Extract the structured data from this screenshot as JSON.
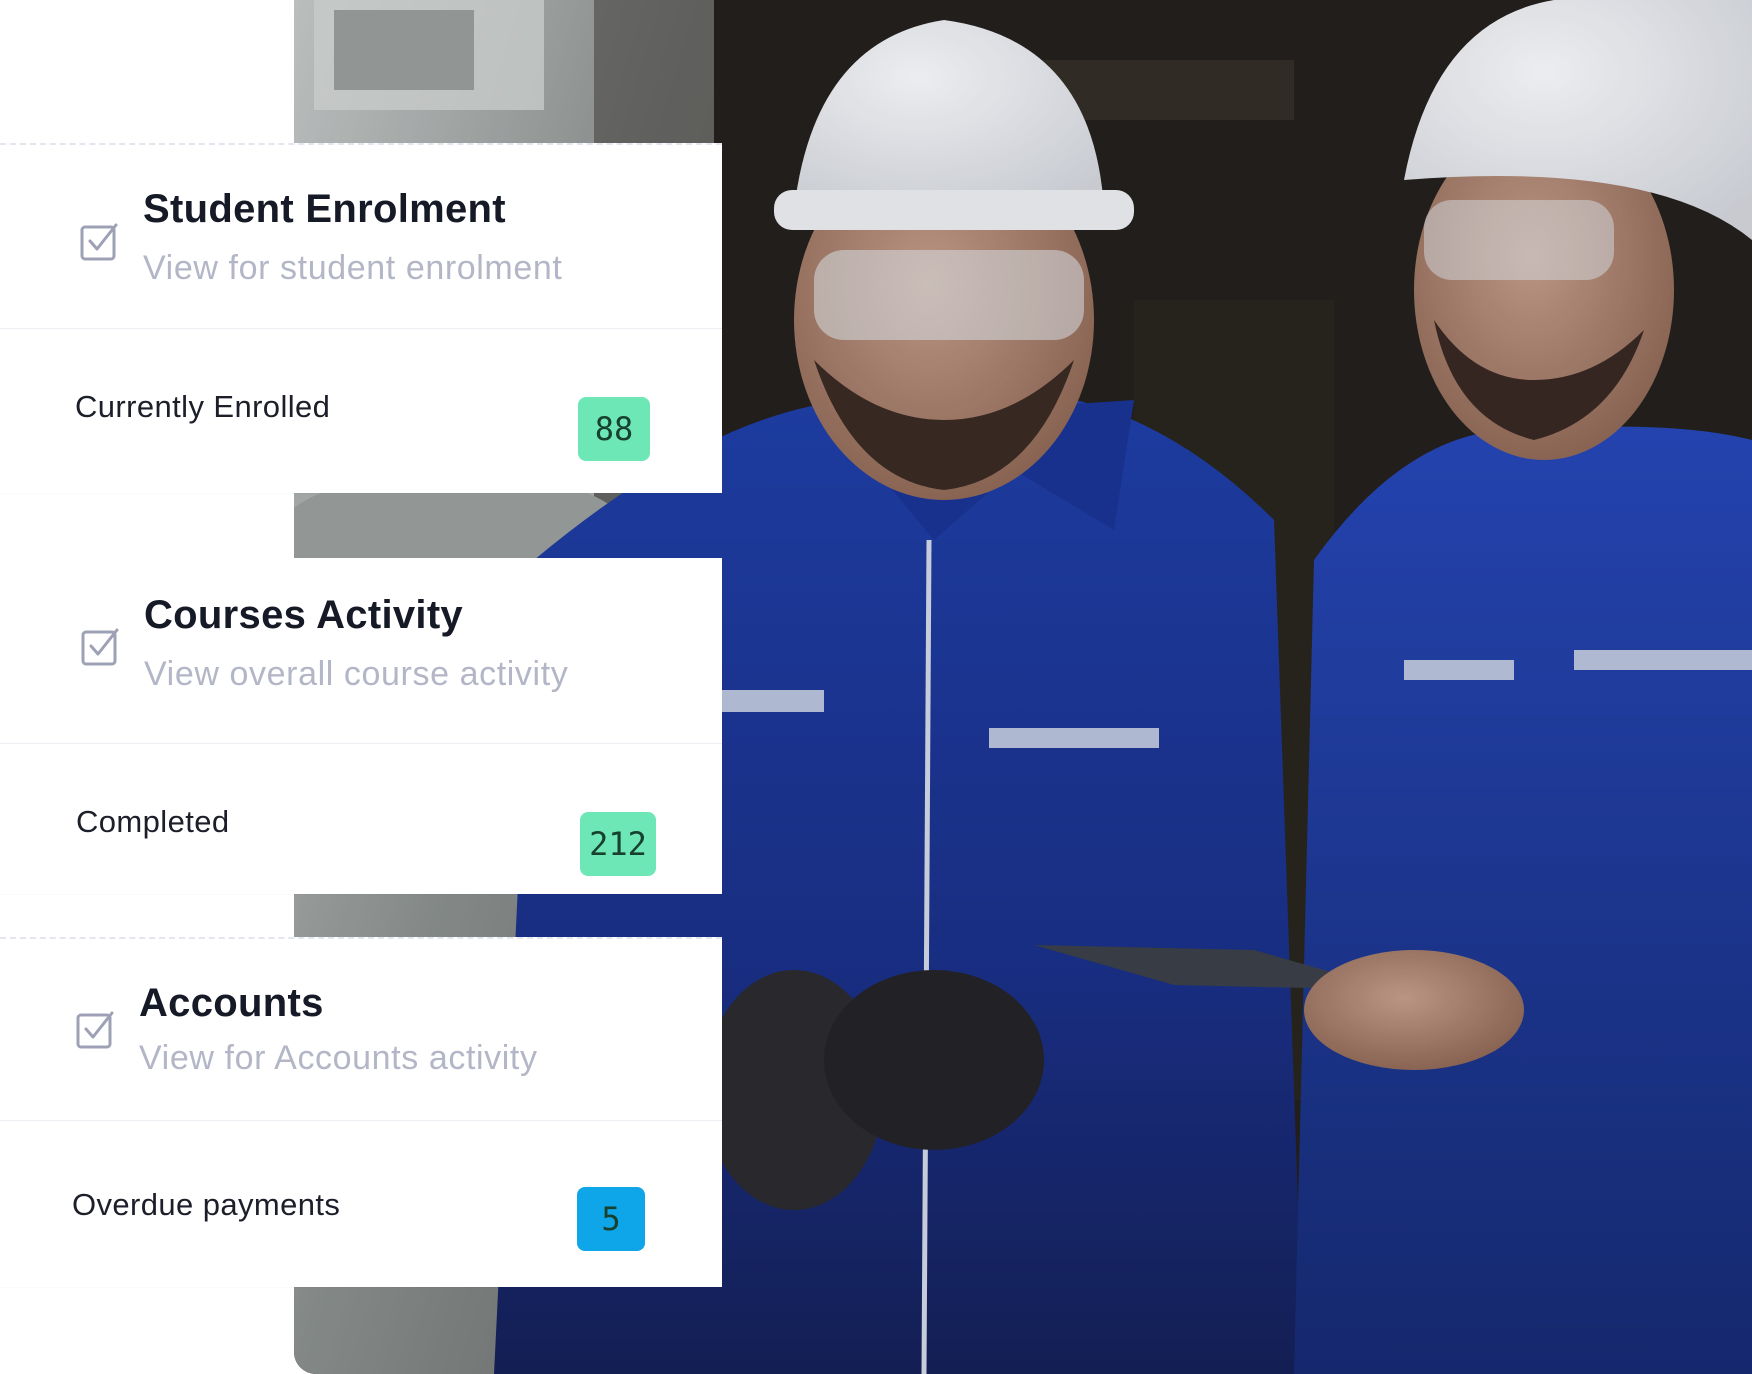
{
  "cards": [
    {
      "title": "Student Enrolment",
      "subtitle": "View for student enrolment",
      "icon": "checkbox-icon",
      "stat_label": "Currently Enrolled",
      "stat_value": "88",
      "badge_color": "#6ee7b7"
    },
    {
      "title": "Courses Activity",
      "subtitle": "View overall course activity",
      "icon": "checkbox-icon",
      "stat_label": "Completed",
      "stat_value": "212",
      "badge_color": "#6ee7b7"
    },
    {
      "title": "Accounts",
      "subtitle": "View for Accounts activity",
      "icon": "checkbox-icon",
      "stat_label": "Overdue payments",
      "stat_value": "5",
      "badge_color": "#0ea5e9"
    }
  ],
  "photo": {
    "subject": "workers-photo"
  }
}
